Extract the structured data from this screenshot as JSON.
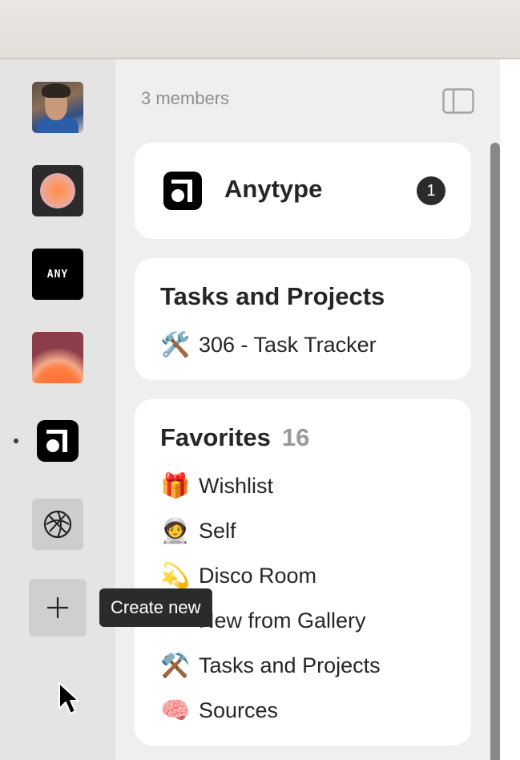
{
  "panel": {
    "members_text": "3 members"
  },
  "workspace": {
    "name": "Anytype",
    "badge_count": "1"
  },
  "tasks_widget": {
    "title": "Tasks and Projects",
    "items": [
      {
        "emoji": "🛠️",
        "label": "306 - Task Tracker"
      }
    ]
  },
  "favorites_widget": {
    "title": "Favorites",
    "count": "16",
    "items": [
      {
        "emoji": "🎁",
        "label": "Wishlist"
      },
      {
        "emoji": "🧑‍🚀",
        "label": "Self"
      },
      {
        "emoji": "💫",
        "label": "Disco Room"
      },
      {
        "emoji": "",
        "label": "New from Gallery"
      },
      {
        "emoji": "⚒️",
        "label": "Tasks and Projects"
      },
      {
        "emoji": "🧠",
        "label": "Sources"
      }
    ]
  },
  "spaces": {
    "any_label": "ANY"
  },
  "tooltip": {
    "text": "Create new"
  },
  "colors": {
    "rail_bg": "#e4e4e4",
    "panel_bg": "#efefef",
    "card_bg": "#ffffff",
    "tooltip_bg": "#2b2b2b"
  },
  "icons": [
    "avatar-photo",
    "gradient-orb",
    "any-logo",
    "sunset-gradient",
    "anytype-logo",
    "globe-icon",
    "plus-icon",
    "sidebar-toggle-icon",
    "mouse-cursor-icon"
  ]
}
